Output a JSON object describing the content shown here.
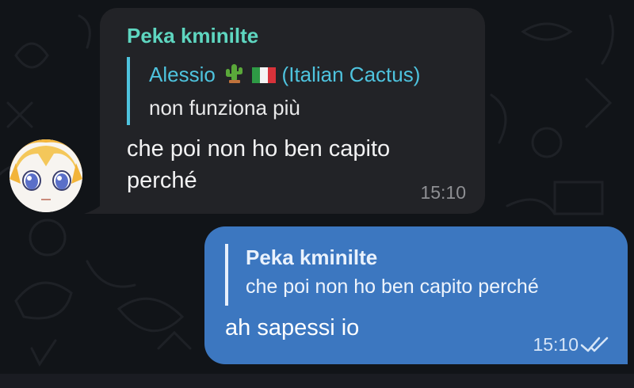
{
  "chat": {
    "incoming": {
      "sender_name": "Peka kminilte",
      "reply": {
        "author_name": "Alessio",
        "author_suffix": "(Italian Cactus)",
        "author_emojis": [
          "cactus-icon",
          "italy-flag-icon"
        ],
        "text": "non funziona più"
      },
      "text": "che poi non ho ben capito perché",
      "time": "15:10",
      "avatar": "anime-avatar"
    },
    "outgoing": {
      "reply": {
        "author_name": "Peka kminilte",
        "text": "che poi non ho ben capito perché"
      },
      "text": "ah sapessi io",
      "time": "15:10",
      "status_icon": "double-check-icon"
    }
  },
  "colors": {
    "background": "#111418",
    "incoming_bubble": "#222327",
    "outgoing_bubble": "#3c77c0",
    "sender_name": "#5ed6c0",
    "reply_accent": "#4ec3de"
  }
}
